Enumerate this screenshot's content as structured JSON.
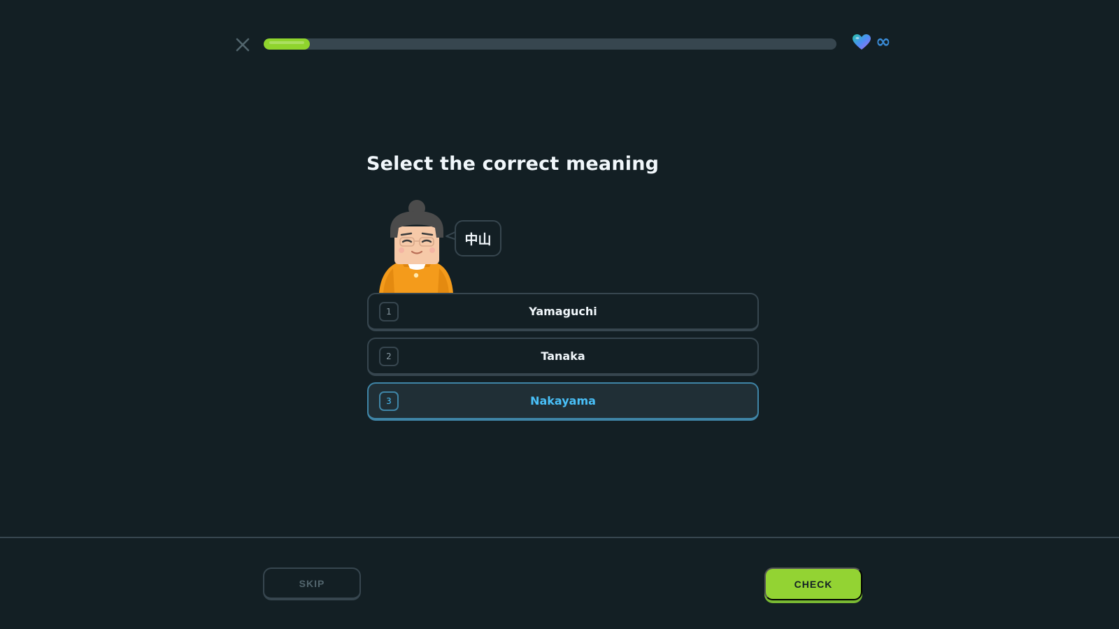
{
  "header": {
    "close_icon": "close-icon",
    "progress": 0.08,
    "hearts_icon": "heart-icon",
    "hearts_value": "∞"
  },
  "challenge": {
    "prompt": "Select the correct meaning",
    "speech": "中山",
    "options": [
      {
        "number": "1",
        "label": "Yamaguchi",
        "selected": false
      },
      {
        "number": "2",
        "label": "Tanaka",
        "selected": false
      },
      {
        "number": "3",
        "label": "Nakayama",
        "selected": true
      }
    ]
  },
  "footer": {
    "skip_label": "SKIP",
    "check_label": "CHECK"
  },
  "colors": {
    "background": "#131f24",
    "progress_fill": "#8fd42d",
    "check_button": "#93d333",
    "selected_accent": "#49c0f8"
  }
}
